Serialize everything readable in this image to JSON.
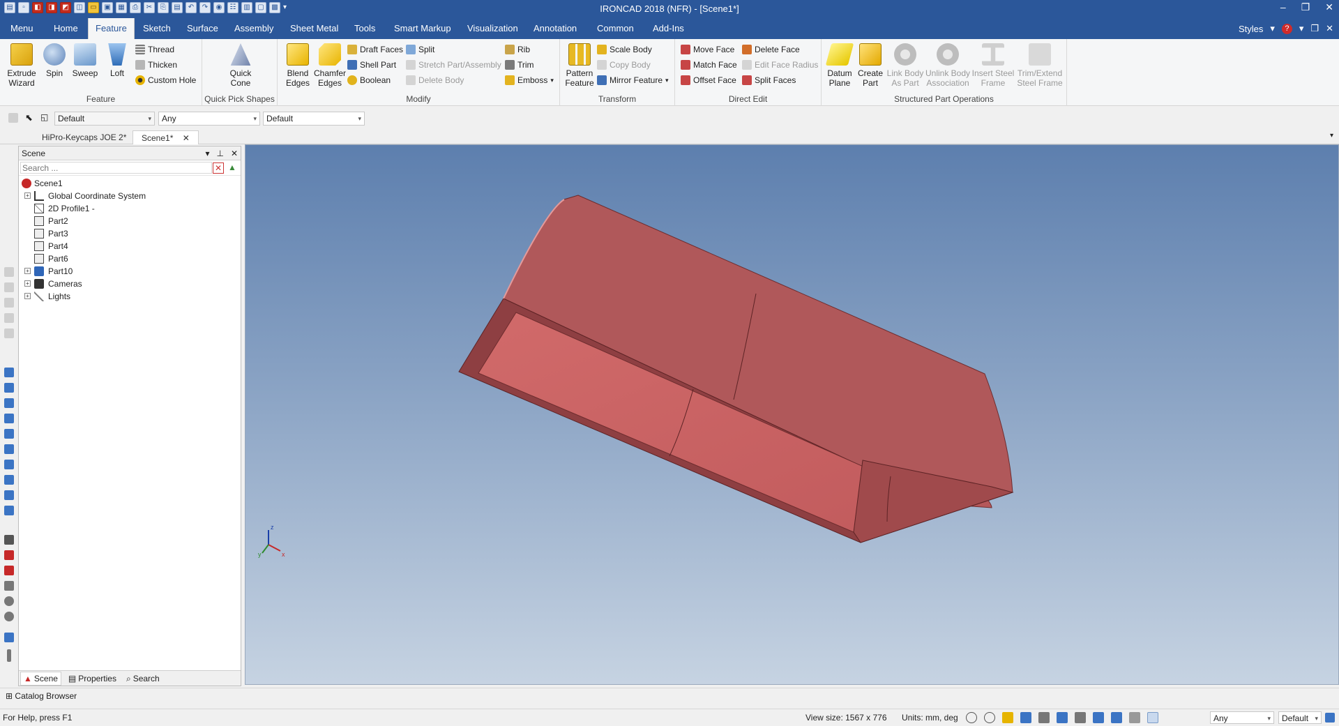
{
  "window": {
    "title": "IRONCAD 2018 (NFR) - [Scene1*]",
    "controls": [
      "–",
      "❐",
      "✕"
    ]
  },
  "ribbon_tabs": [
    {
      "label": "Menu"
    },
    {
      "label": "Home"
    },
    {
      "label": "Feature"
    },
    {
      "label": "Sketch"
    },
    {
      "label": "Surface"
    },
    {
      "label": "Assembly"
    },
    {
      "label": "Sheet Metal"
    },
    {
      "label": "Tools"
    },
    {
      "label": "Smart Markup"
    },
    {
      "label": "Visualization"
    },
    {
      "label": "Annotation"
    },
    {
      "label": "Common"
    },
    {
      "label": "Add-Ins"
    }
  ],
  "ribbon_right": {
    "styles": "Styles",
    "help": "?"
  },
  "groups": {
    "feature": {
      "label": "Feature",
      "extrude": "Extrude\nWizard",
      "spin": "Spin",
      "sweep": "Sweep",
      "loft": "Loft",
      "thread": "Thread",
      "thicken": "Thicken",
      "custom_hole": "Custom Hole"
    },
    "quick": {
      "label": "Quick Pick Shapes",
      "cone": "Quick\nCone"
    },
    "modify": {
      "label": "Modify",
      "blend": "Blend\nEdges",
      "chamfer": "Chamfer\nEdges",
      "draft": "Draft Faces",
      "shell": "Shell Part",
      "boolean": "Boolean",
      "split": "Split",
      "stretch": "Stretch Part/Assembly",
      "delete_body": "Delete Body",
      "rib": "Rib",
      "trim": "Trim",
      "emboss": "Emboss"
    },
    "transform": {
      "label": "Transform",
      "pattern": "Pattern\nFeature",
      "scale": "Scale Body",
      "copy": "Copy Body",
      "mirror": "Mirror Feature"
    },
    "direct": {
      "label": "Direct Edit",
      "move": "Move Face",
      "match": "Match Face",
      "offset": "Offset Face",
      "delete_face": "Delete Face",
      "edit_radius": "Edit Face Radius",
      "split_faces": "Split Faces"
    },
    "structured": {
      "label": "Structured Part Operations",
      "datum": "Datum\nPlane",
      "create": "Create\nPart",
      "link": "Link Body\nAs Part",
      "unlink": "Unlink Body\nAssociation",
      "insert_steel": "Insert Steel\nFrame",
      "trim_extend": "Trim/Extend\nSteel Frame"
    }
  },
  "toolbar": {
    "style_combo": "Default",
    "filter_combo": "Any",
    "material_combo": "Default"
  },
  "doc_tabs": [
    {
      "label": "HiPro-Keycaps JOE 2*"
    },
    {
      "label": "Scene1*"
    }
  ],
  "scene_panel": {
    "title": "Scene",
    "search_placeholder": "Search ...",
    "tree": [
      {
        "label": "Scene1",
        "icon": "scene-icon"
      },
      {
        "label": "Global Coordinate System",
        "icon": "axes-icon"
      },
      {
        "label": "2D Profile1 -",
        "icon": "profile-icon"
      },
      {
        "label": "Part2",
        "icon": "part-icon"
      },
      {
        "label": "Part3",
        "icon": "part-icon"
      },
      {
        "label": "Part4",
        "icon": "part-icon"
      },
      {
        "label": "Part6",
        "icon": "part-icon"
      },
      {
        "label": "Part10",
        "icon": "part-icon"
      },
      {
        "label": "Cameras",
        "icon": "camera-icon"
      },
      {
        "label": "Lights",
        "icon": "light-icon"
      }
    ],
    "footer_tabs": [
      {
        "label": "Scene"
      },
      {
        "label": "Properties"
      },
      {
        "label": "Search"
      }
    ]
  },
  "catalog": {
    "label": "Catalog Browser"
  },
  "status": {
    "help": "For Help, press F1",
    "view_size": "View size: 1567 x  776",
    "units": "Units: mm, deg",
    "filter": "Any",
    "style": "Default"
  },
  "triad": {
    "x": "x",
    "y": "y",
    "z": "z"
  },
  "colors": {
    "accent": "#2b579a",
    "model_fill": "#c15f5f",
    "model_dark": "#8f3f40",
    "viewport_top": "#5d7fae",
    "viewport_bottom": "#c6d3e2"
  }
}
